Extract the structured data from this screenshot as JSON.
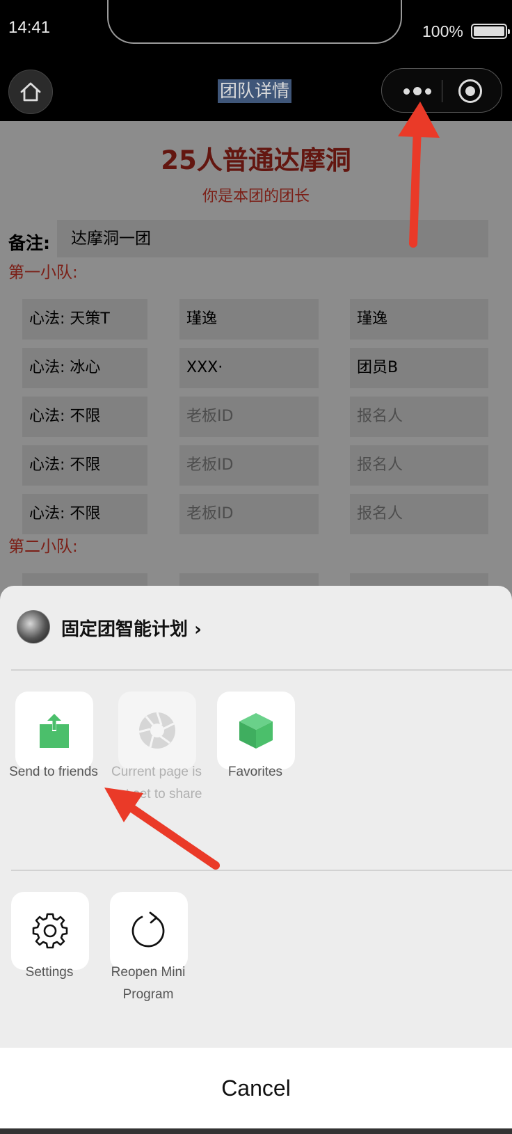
{
  "status_bar": {
    "time": "14:41",
    "battery": "100%"
  },
  "nav": {
    "title": "团队详情"
  },
  "page": {
    "title": "25人普通达摩洞",
    "subtitle": "你是本团的团长",
    "remark_label": "备注:",
    "remark_value": "达摩洞一团",
    "squad1_label": "第一小队:",
    "squad2_label": "第二小队:",
    "rows": [
      {
        "xinfa": "心法: 天策T",
        "boss": "瑾逸",
        "member": "瑾逸",
        "boss_placeholder": false,
        "member_placeholder": false
      },
      {
        "xinfa": "心法: 冰心",
        "boss": "XXX·",
        "member": "团员B",
        "boss_placeholder": false,
        "member_placeholder": false
      },
      {
        "xinfa": "心法: 不限",
        "boss": "老板ID",
        "member": "报名人",
        "boss_placeholder": true,
        "member_placeholder": true
      },
      {
        "xinfa": "心法: 不限",
        "boss": "老板ID",
        "member": "报名人",
        "boss_placeholder": true,
        "member_placeholder": true
      },
      {
        "xinfa": "心法: 不限",
        "boss": "老板ID",
        "member": "报名人",
        "boss_placeholder": true,
        "member_placeholder": true
      }
    ]
  },
  "sheet": {
    "app_name": "固定团智能计划",
    "row1": [
      {
        "label": "Send to friends",
        "icon": "share-upload-icon",
        "enabled": true
      },
      {
        "label": "Current page is not set to share",
        "icon": "shutter-icon",
        "enabled": false
      },
      {
        "label": "Favorites",
        "icon": "cube-icon",
        "enabled": true
      }
    ],
    "row2": [
      {
        "label": "Settings",
        "icon": "gear-icon",
        "enabled": true
      },
      {
        "label": "Reopen Mini Program",
        "icon": "refresh-icon",
        "enabled": true
      }
    ],
    "cancel": "Cancel"
  },
  "colors": {
    "accent_red": "#e03a2a",
    "share_green": "#4bbf6b",
    "annotation_red": "#ea3a28"
  }
}
